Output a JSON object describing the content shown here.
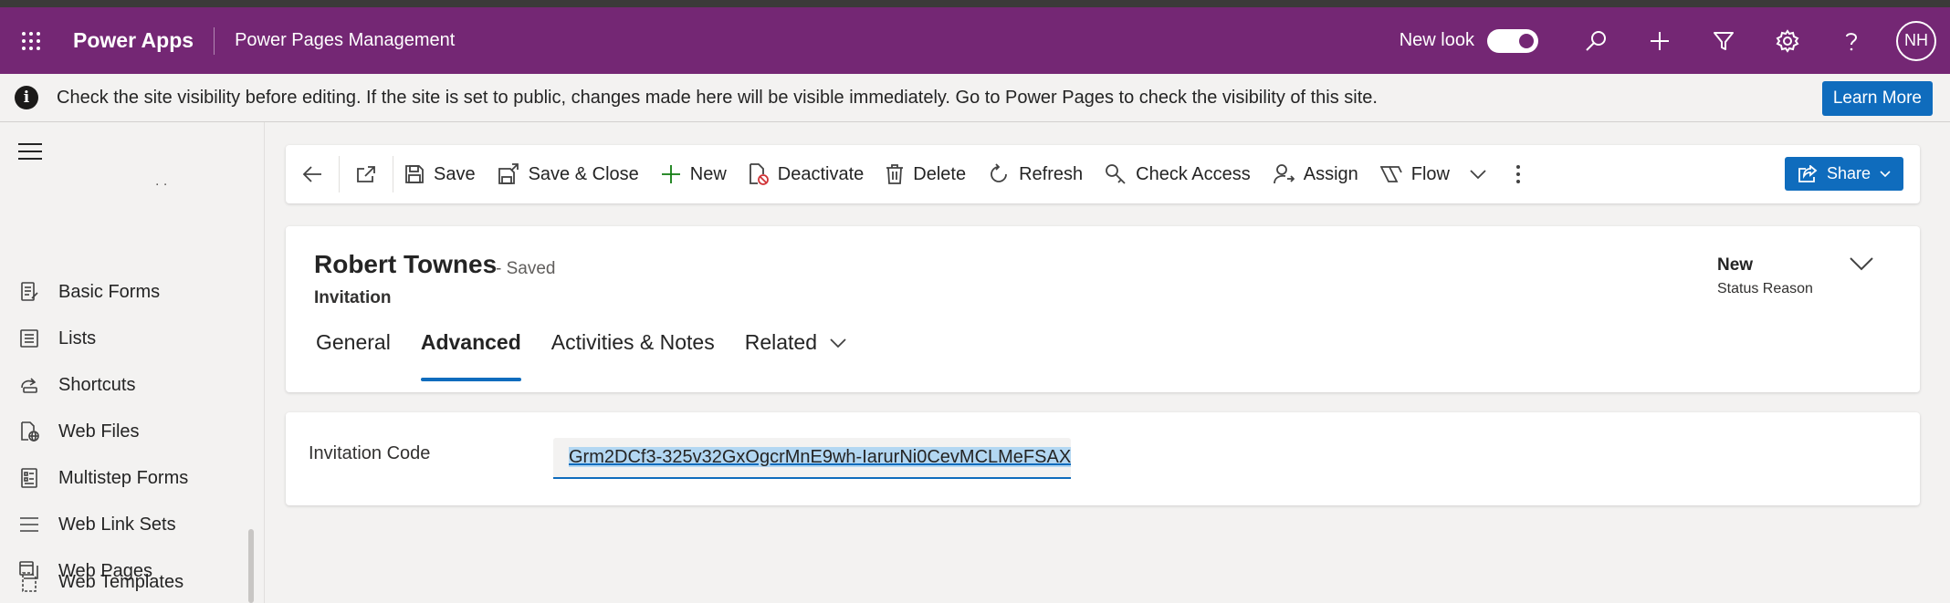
{
  "topbar": {
    "app_name": "Power Apps",
    "environment_name": "Power Pages Management",
    "new_look_label": "New look",
    "new_look_enabled": true,
    "avatar_initials": "NH",
    "brand_color": "#742774"
  },
  "notice": {
    "message": "Check the site visibility before editing. If the site is set to public, changes made here will be visible immediately. Go to Power Pages to check the visibility of this site.",
    "button_label": "Learn More"
  },
  "sidebar": {
    "partial_label": ". .",
    "items": [
      {
        "label": "Basic Forms",
        "icon": "form-icon"
      },
      {
        "label": "Lists",
        "icon": "list-icon"
      },
      {
        "label": "Shortcuts",
        "icon": "shortcut-icon"
      },
      {
        "label": "Web Files",
        "icon": "web-file-icon"
      },
      {
        "label": "Multistep Forms",
        "icon": "multistep-form-icon"
      },
      {
        "label": "Web Link Sets",
        "icon": "link-set-icon"
      },
      {
        "label": "Web Pages",
        "icon": "web-page-icon"
      },
      {
        "label": "Web Templates",
        "icon": "template-icon"
      }
    ]
  },
  "commands": {
    "save": "Save",
    "save_close": "Save & Close",
    "new": "New",
    "deactivate": "Deactivate",
    "delete": "Delete",
    "refresh": "Refresh",
    "check_access": "Check Access",
    "assign": "Assign",
    "flow": "Flow",
    "share": "Share"
  },
  "record": {
    "title": "Robert Townes",
    "saved_status": "- Saved",
    "entity": "Invitation",
    "status_value": "New",
    "status_label": "Status Reason"
  },
  "tabs": [
    "General",
    "Advanced",
    "Activities & Notes",
    "Related"
  ],
  "active_tab": "Advanced",
  "field": {
    "label": "Invitation Code",
    "value": "Grm2DCf3-325v32GxOgcrMnE9wh-IarurNi0CevMCLMeFSAX"
  },
  "accent_color": "#0f6cbd"
}
